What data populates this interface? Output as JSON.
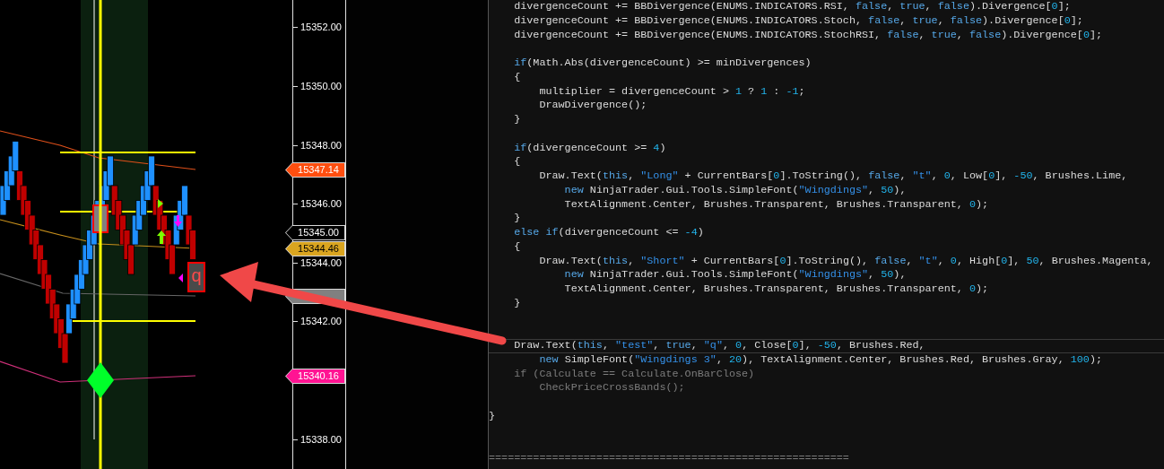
{
  "chart": {
    "price_axis": {
      "ticks": [
        "15352.00",
        "15350.00",
        "15348.00",
        "15346.00",
        "15344.00",
        "15342.00",
        "15338.00"
      ],
      "tags": [
        {
          "text": "15347.14",
          "color": "#ff4e0f"
        },
        {
          "text": "15345.00",
          "color": "#000000"
        },
        {
          "text": "15344.46",
          "color": "#daa520"
        },
        {
          "color": "#808080"
        },
        {
          "text": "15340.16",
          "color": "#ff1493"
        }
      ]
    },
    "text_marker": {
      "text": "q"
    }
  },
  "editor": {
    "lines": [
      {
        "kind": "code",
        "highlighted": false,
        "tokens": [
          {
            "kind": "plain",
            "text": "    divergenceCount += BBDivergence(ENUMS.INDICATORS.RSI, "
          },
          {
            "kind": "keyword",
            "text": "false"
          },
          {
            "kind": "plain",
            "text": ", "
          },
          {
            "kind": "keyword",
            "text": "true"
          },
          {
            "kind": "plain",
            "text": ", "
          },
          {
            "kind": "keyword",
            "text": "false"
          },
          {
            "kind": "plain",
            "text": ").Divergence["
          },
          {
            "kind": "number",
            "text": "0"
          },
          {
            "kind": "plain",
            "text": "];"
          }
        ]
      },
      {
        "kind": "code",
        "highlighted": false,
        "tokens": [
          {
            "kind": "plain",
            "text": "    divergenceCount += BBDivergence(ENUMS.INDICATORS.Stoch, "
          },
          {
            "kind": "keyword",
            "text": "false"
          },
          {
            "kind": "plain",
            "text": ", "
          },
          {
            "kind": "keyword",
            "text": "true"
          },
          {
            "kind": "plain",
            "text": ", "
          },
          {
            "kind": "keyword",
            "text": "false"
          },
          {
            "kind": "plain",
            "text": ").Divergence["
          },
          {
            "kind": "number",
            "text": "0"
          },
          {
            "kind": "plain",
            "text": "];"
          }
        ]
      },
      {
        "kind": "code",
        "highlighted": false,
        "tokens": [
          {
            "kind": "plain",
            "text": "    divergenceCount += BBDivergence(ENUMS.INDICATORS.StochRSI, "
          },
          {
            "kind": "keyword",
            "text": "false"
          },
          {
            "kind": "plain",
            "text": ", "
          },
          {
            "kind": "keyword",
            "text": "true"
          },
          {
            "kind": "plain",
            "text": ", "
          },
          {
            "kind": "keyword",
            "text": "false"
          },
          {
            "kind": "plain",
            "text": ").Divergence["
          },
          {
            "kind": "number",
            "text": "0"
          },
          {
            "kind": "plain",
            "text": "];"
          }
        ]
      },
      {
        "kind": "blank"
      },
      {
        "kind": "code",
        "highlighted": false,
        "tokens": [
          {
            "kind": "keyword",
            "text": "    if"
          },
          {
            "kind": "plain",
            "text": "(Math.Abs(divergenceCount) >= minDivergences)"
          }
        ]
      },
      {
        "kind": "code",
        "highlighted": false,
        "tokens": [
          {
            "kind": "plain",
            "text": "    {"
          }
        ]
      },
      {
        "kind": "code",
        "highlighted": false,
        "tokens": [
          {
            "kind": "plain",
            "text": "        multiplier = divergenceCount > "
          },
          {
            "kind": "number",
            "text": "1"
          },
          {
            "kind": "plain",
            "text": " ? "
          },
          {
            "kind": "number",
            "text": "1"
          },
          {
            "kind": "plain",
            "text": " : "
          },
          {
            "kind": "number",
            "text": "-1"
          },
          {
            "kind": "plain",
            "text": ";"
          }
        ]
      },
      {
        "kind": "code",
        "highlighted": false,
        "tokens": [
          {
            "kind": "plain",
            "text": "        DrawDivergence();"
          }
        ]
      },
      {
        "kind": "code",
        "highlighted": false,
        "tokens": [
          {
            "kind": "plain",
            "text": "    }"
          }
        ]
      },
      {
        "kind": "blank"
      },
      {
        "kind": "code",
        "highlighted": false,
        "tokens": [
          {
            "kind": "keyword",
            "text": "    if"
          },
          {
            "kind": "plain",
            "text": "(divergenceCount >= "
          },
          {
            "kind": "number",
            "text": "4"
          },
          {
            "kind": "plain",
            "text": ")"
          }
        ]
      },
      {
        "kind": "code",
        "highlighted": false,
        "tokens": [
          {
            "kind": "plain",
            "text": "    {"
          }
        ]
      },
      {
        "kind": "code",
        "highlighted": false,
        "tokens": [
          {
            "kind": "plain",
            "text": "        Draw.Text("
          },
          {
            "kind": "keyword",
            "text": "this"
          },
          {
            "kind": "plain",
            "text": ", "
          },
          {
            "kind": "string",
            "text": "\"Long\""
          },
          {
            "kind": "plain",
            "text": " + CurrentBars["
          },
          {
            "kind": "number",
            "text": "0"
          },
          {
            "kind": "plain",
            "text": "].ToString(), "
          },
          {
            "kind": "keyword",
            "text": "false"
          },
          {
            "kind": "plain",
            "text": ", "
          },
          {
            "kind": "string",
            "text": "\"t\""
          },
          {
            "kind": "plain",
            "text": ", "
          },
          {
            "kind": "number",
            "text": "0"
          },
          {
            "kind": "plain",
            "text": ", Low["
          },
          {
            "kind": "number",
            "text": "0"
          },
          {
            "kind": "plain",
            "text": "], "
          },
          {
            "kind": "number",
            "text": "-50"
          },
          {
            "kind": "plain",
            "text": ", Brushes.Lime,"
          }
        ]
      },
      {
        "kind": "code",
        "highlighted": false,
        "tokens": [
          {
            "kind": "keyword",
            "text": "            new"
          },
          {
            "kind": "plain",
            "text": " NinjaTrader.Gui.Tools.SimpleFont("
          },
          {
            "kind": "string",
            "text": "\"Wingdings\""
          },
          {
            "kind": "plain",
            "text": ", "
          },
          {
            "kind": "number",
            "text": "50"
          },
          {
            "kind": "plain",
            "text": "),"
          }
        ]
      },
      {
        "kind": "code",
        "highlighted": false,
        "tokens": [
          {
            "kind": "plain",
            "text": "            TextAlignment.Center, Brushes.Transparent, Brushes.Transparent, "
          },
          {
            "kind": "number",
            "text": "0"
          },
          {
            "kind": "plain",
            "text": ");"
          }
        ]
      },
      {
        "kind": "code",
        "highlighted": false,
        "tokens": [
          {
            "kind": "plain",
            "text": "    }"
          }
        ]
      },
      {
        "kind": "code",
        "highlighted": false,
        "tokens": [
          {
            "kind": "keyword",
            "text": "    else if"
          },
          {
            "kind": "plain",
            "text": "(divergenceCount <= "
          },
          {
            "kind": "number",
            "text": "-4"
          },
          {
            "kind": "plain",
            "text": ")"
          }
        ]
      },
      {
        "kind": "code",
        "highlighted": false,
        "tokens": [
          {
            "kind": "plain",
            "text": "    {"
          }
        ]
      },
      {
        "kind": "code",
        "highlighted": false,
        "tokens": [
          {
            "kind": "plain",
            "text": "        Draw.Text("
          },
          {
            "kind": "keyword",
            "text": "this"
          },
          {
            "kind": "plain",
            "text": ", "
          },
          {
            "kind": "string",
            "text": "\"Short\""
          },
          {
            "kind": "plain",
            "text": " + CurrentBars["
          },
          {
            "kind": "number",
            "text": "0"
          },
          {
            "kind": "plain",
            "text": "].ToString(), "
          },
          {
            "kind": "keyword",
            "text": "false"
          },
          {
            "kind": "plain",
            "text": ", "
          },
          {
            "kind": "string",
            "text": "\"t\""
          },
          {
            "kind": "plain",
            "text": ", "
          },
          {
            "kind": "number",
            "text": "0"
          },
          {
            "kind": "plain",
            "text": ", High["
          },
          {
            "kind": "number",
            "text": "0"
          },
          {
            "kind": "plain",
            "text": "], "
          },
          {
            "kind": "number",
            "text": "50"
          },
          {
            "kind": "plain",
            "text": ", Brushes.Magenta,"
          }
        ]
      },
      {
        "kind": "code",
        "highlighted": false,
        "tokens": [
          {
            "kind": "keyword",
            "text": "            new"
          },
          {
            "kind": "plain",
            "text": " NinjaTrader.Gui.Tools.SimpleFont("
          },
          {
            "kind": "string",
            "text": "\"Wingdings\""
          },
          {
            "kind": "plain",
            "text": ", "
          },
          {
            "kind": "number",
            "text": "50"
          },
          {
            "kind": "plain",
            "text": "),"
          }
        ]
      },
      {
        "kind": "code",
        "highlighted": false,
        "tokens": [
          {
            "kind": "plain",
            "text": "            TextAlignment.Center, Brushes.Transparent, Brushes.Transparent, "
          },
          {
            "kind": "number",
            "text": "0"
          },
          {
            "kind": "plain",
            "text": ");"
          }
        ]
      },
      {
        "kind": "code",
        "highlighted": false,
        "tokens": [
          {
            "kind": "plain",
            "text": "    }"
          }
        ]
      },
      {
        "kind": "blank"
      },
      {
        "kind": "blank"
      },
      {
        "kind": "code",
        "highlighted": true,
        "tokens": [
          {
            "kind": "plain",
            "text": "    Draw.Text("
          },
          {
            "kind": "keyword",
            "text": "this"
          },
          {
            "kind": "plain",
            "text": ", "
          },
          {
            "kind": "string",
            "text": "\"test\""
          },
          {
            "kind": "plain",
            "text": ", "
          },
          {
            "kind": "keyword",
            "text": "true"
          },
          {
            "kind": "plain",
            "text": ", "
          },
          {
            "kind": "string",
            "text": "\"q\""
          },
          {
            "kind": "plain",
            "text": ", "
          },
          {
            "kind": "number",
            "text": "0"
          },
          {
            "kind": "plain",
            "text": ", Close["
          },
          {
            "kind": "number",
            "text": "0"
          },
          {
            "kind": "plain",
            "text": "], "
          },
          {
            "kind": "number",
            "text": "-50"
          },
          {
            "kind": "plain",
            "text": ", Brushes.Red,"
          }
        ]
      },
      {
        "kind": "code",
        "highlighted": false,
        "tokens": [
          {
            "kind": "keyword",
            "text": "        new"
          },
          {
            "kind": "plain",
            "text": " SimpleFont("
          },
          {
            "kind": "string",
            "text": "\"Wingdings 3\""
          },
          {
            "kind": "plain",
            "text": ", "
          },
          {
            "kind": "number",
            "text": "20"
          },
          {
            "kind": "plain",
            "text": "), TextAlignment.Center, Brushes.Red, Brushes.Gray, "
          },
          {
            "kind": "number",
            "text": "100"
          },
          {
            "kind": "plain",
            "text": ");"
          }
        ]
      },
      {
        "kind": "code",
        "highlighted": false,
        "tokens": [
          {
            "kind": "dim",
            "text": "    if (Calculate == Calculate.OnBarClose)"
          }
        ]
      },
      {
        "kind": "code",
        "highlighted": false,
        "tokens": [
          {
            "kind": "dim",
            "text": "        CheckPriceCrossBands();"
          }
        ]
      },
      {
        "kind": "blank"
      },
      {
        "kind": "code",
        "highlighted": false,
        "tokens": [
          {
            "kind": "plain",
            "text": "}"
          }
        ]
      },
      {
        "kind": "blank"
      },
      {
        "kind": "blank"
      },
      {
        "kind": "code",
        "highlighted": false,
        "tokens": [
          {
            "kind": "dim",
            "text": "========================================================="
          }
        ]
      }
    ]
  }
}
